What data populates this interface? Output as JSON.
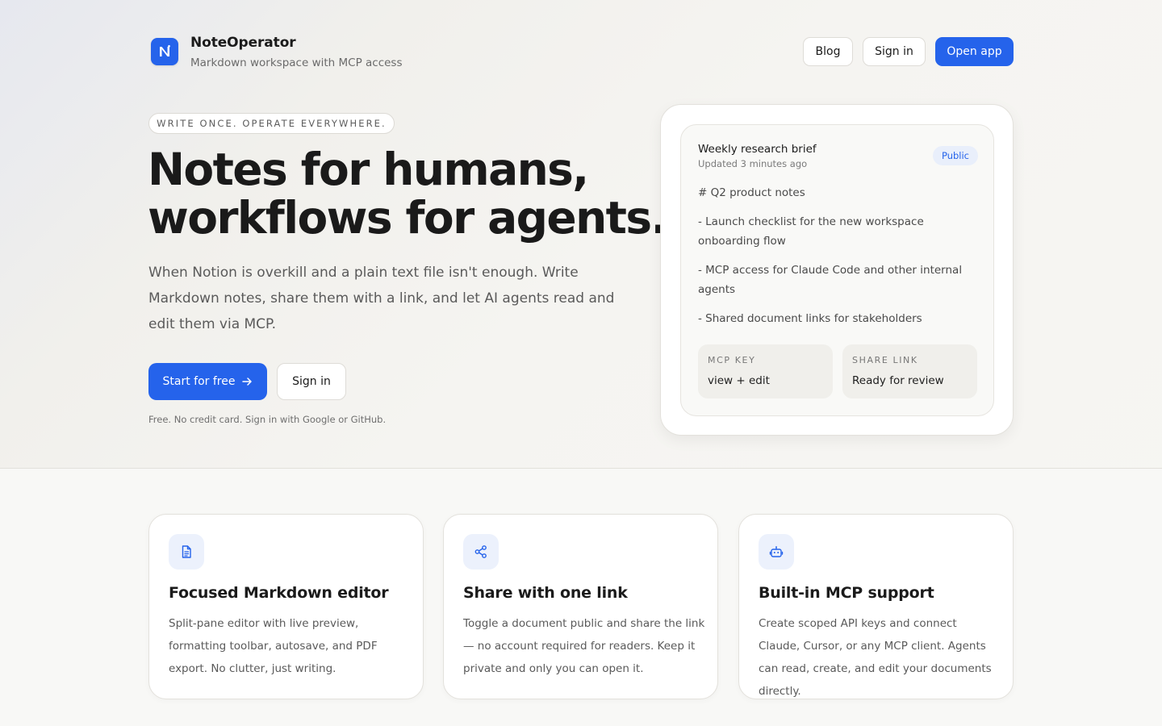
{
  "brand": {
    "logo_letter": "N",
    "name": "NoteOperator",
    "tagline": "Markdown workspace with MCP access"
  },
  "nav": {
    "blog": "Blog",
    "sign_in": "Sign in",
    "open_app": "Open app"
  },
  "hero": {
    "eyebrow": "WRITE ONCE. OPERATE EVERYWHERE.",
    "title_line1": "Notes for humans,",
    "title_line2": "workflows for agents.",
    "description": "When Notion is overkill and a plain text file isn't enough. Write Markdown notes, share them with a link, and let AI agents read and edit them via MCP.",
    "cta_primary": "Start for free",
    "cta_secondary": "Sign in",
    "note": "Free. No credit card. Sign in with Google or GitHub."
  },
  "preview": {
    "doc_title": "Weekly research brief",
    "updated": "Updated 3 minutes ago",
    "badge": "Public",
    "lines": [
      "# Q2 product notes",
      "- Launch checklist for the new workspace onboarding flow",
      "- MCP access for Claude Code and other internal agents",
      "- Shared document links for stakeholders"
    ],
    "mcp_key_label": "MCP KEY",
    "mcp_key_value": "view + edit",
    "share_link_label": "SHARE LINK",
    "share_link_value": "Ready for review"
  },
  "features": [
    {
      "icon": "document-icon",
      "title": "Focused Markdown editor",
      "description": "Split-pane editor with live preview, formatting toolbar, autosave, and PDF export. No clutter, just writing."
    },
    {
      "icon": "share-icon",
      "title": "Share with one link",
      "description": "Toggle a document public and share the link — no account required for readers. Keep it private and only you can open it."
    },
    {
      "icon": "robot-icon",
      "title": "Built-in MCP support",
      "description": "Create scoped API keys and connect Claude, Cursor, or any MCP client. Agents can read, create, and edit your documents directly."
    }
  ],
  "colors": {
    "accent": "#2563eb",
    "badge_bg": "#e9effb",
    "text": "#1a1a1a",
    "muted": "#5a5a5a"
  }
}
